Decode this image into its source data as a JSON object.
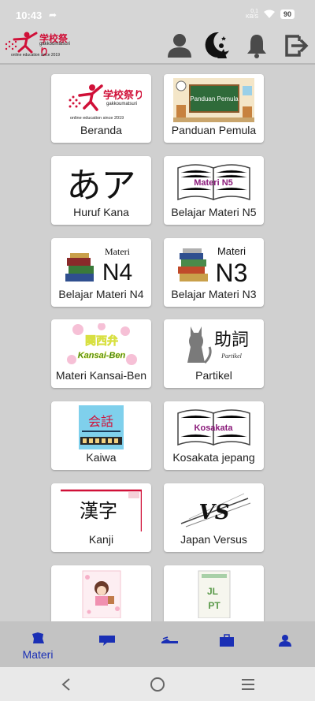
{
  "status_bar": {
    "time": "10:43",
    "battery": "90",
    "net_line1": "0,1",
    "net_line2": "KB/S"
  },
  "app": {
    "logo_main": "学校祭り",
    "logo_sub": "gakkoumatsuri",
    "logo_tagline": "online education since 2019",
    "header_icons": [
      "user-icon",
      "moon-logo-icon",
      "bell-icon",
      "logout-icon"
    ]
  },
  "menu": [
    {
      "label": "Beranda",
      "icon": "gakkoumatsuri-logo"
    },
    {
      "label": "Panduan Pemula",
      "icon": "classroom-board",
      "board_text": "Panduan Pemula"
    },
    {
      "label": "Huruf Kana",
      "icon": "kana-glyphs",
      "glyph": "あア"
    },
    {
      "label": "Belajar Materi N5",
      "icon": "open-book",
      "book_text": "Materi N5"
    },
    {
      "label": "Belajar Materi N4",
      "icon": "books-stack",
      "title_small": "Materi",
      "title_big": "N4"
    },
    {
      "label": "Belajar Materi N3",
      "icon": "books-stack",
      "title_small": "Materi",
      "title_big": "N3"
    },
    {
      "label": "Materi Kansai-Ben",
      "icon": "kansai-ben",
      "text_top": "関西弁",
      "text_bottom": "Kansai-Ben"
    },
    {
      "label": "Partikel",
      "icon": "cat-partikel",
      "kanji": "助詞",
      "caption": "Partikel"
    },
    {
      "label": "Kaiwa",
      "icon": "kaiwa",
      "kanji": "会話"
    },
    {
      "label": "Kosakata jepang",
      "icon": "open-book",
      "book_text": "Kosakata"
    },
    {
      "label": "Kanji",
      "icon": "kanji",
      "kanji": "漢字"
    },
    {
      "label": "Japan Versus",
      "icon": "versus",
      "text": "VS"
    },
    {
      "label": "",
      "icon": "girl-illustration"
    },
    {
      "label": "",
      "icon": "jlpt-book",
      "text_top": "JL",
      "text_bottom": "PT"
    }
  ],
  "bottom_nav": [
    {
      "label": "Materi",
      "icon": "materi-icon",
      "active": true
    },
    {
      "label": "",
      "icon": "chat-icon"
    },
    {
      "label": "",
      "icon": "shoes-icon"
    },
    {
      "label": "",
      "icon": "briefcase-icon"
    },
    {
      "label": "",
      "icon": "profile-icon"
    }
  ],
  "colors": {
    "nav_accent": "#1a2fb5",
    "brand_red": "#d01038",
    "background": "#d0d0d0"
  }
}
